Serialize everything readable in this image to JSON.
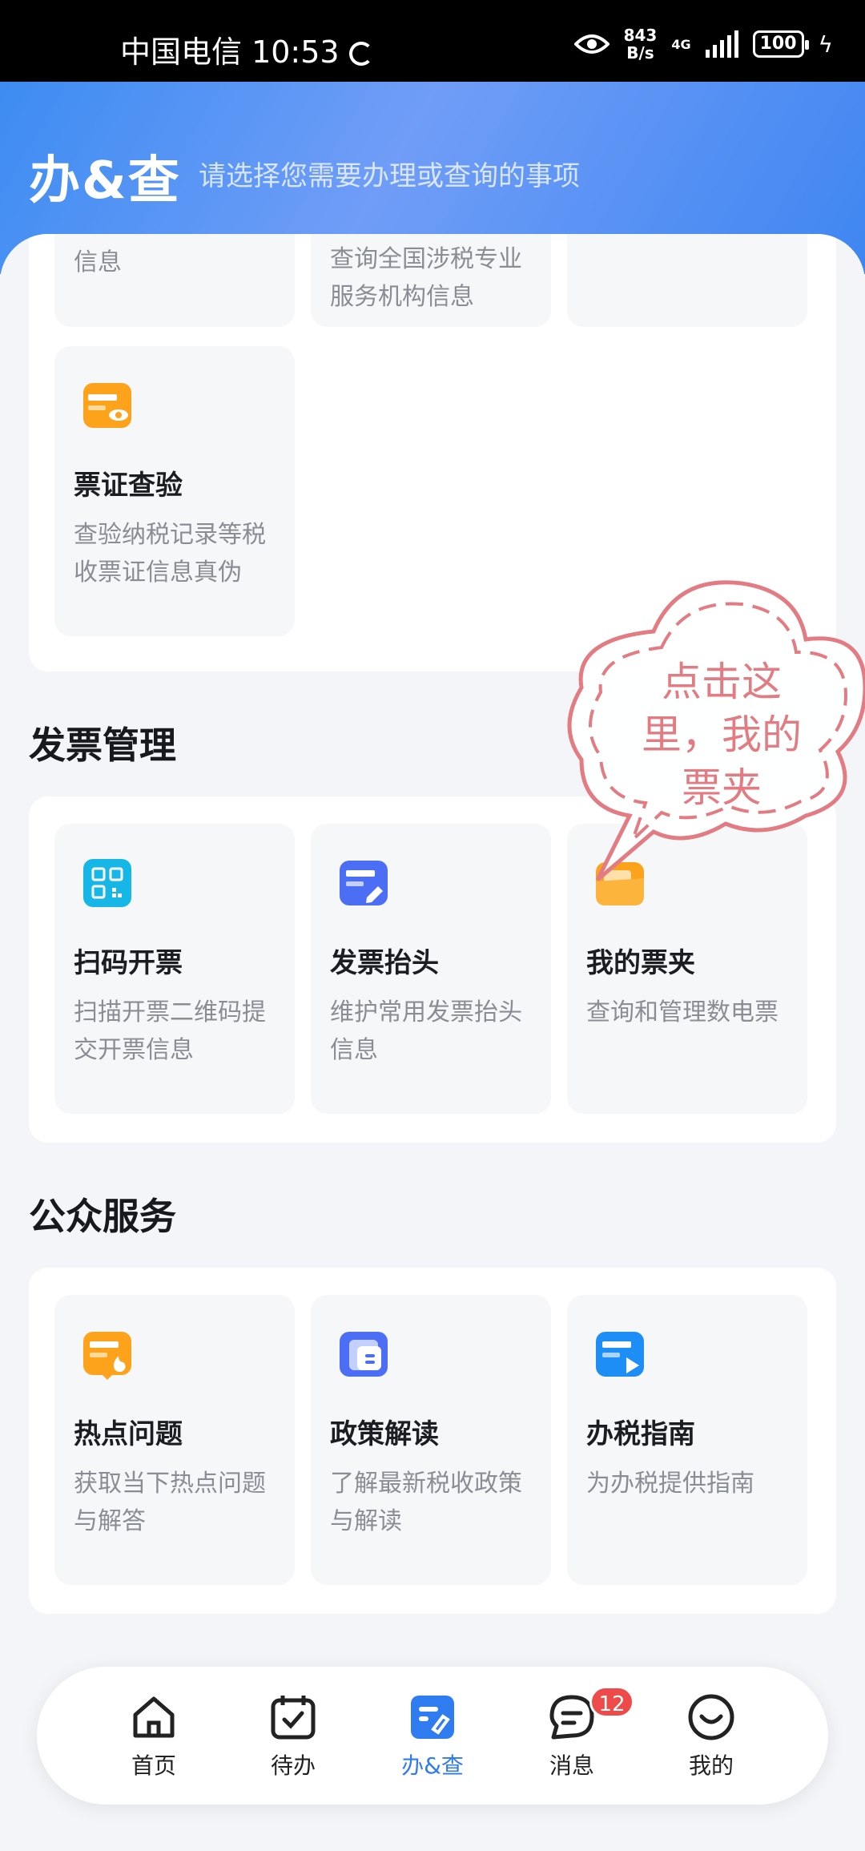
{
  "status_bar": {
    "carrier_time": "中国电信 10:53",
    "speed_value": "843",
    "speed_unit": "B/s",
    "network": "4G",
    "battery": "100"
  },
  "header": {
    "title": "办&查",
    "subtitle": "请选择您需要办理或查询的事项"
  },
  "top_card": {
    "partial_tiles": [
      {
        "desc": "信息"
      },
      {
        "desc": "查询全国涉税专业服务机构信息"
      },
      {
        "desc": ""
      }
    ],
    "tile": {
      "name": "票证查验",
      "desc": "查验纳税记录等税收票证信息真伪",
      "icon": "ticket-verify-icon"
    }
  },
  "invoice_section": {
    "title": "发票管理",
    "tiles": [
      {
        "name": "扫码开票",
        "desc": "扫描开票二维码提交开票信息",
        "icon": "qr-scan-icon"
      },
      {
        "name": "发票抬头",
        "desc": "维护常用发票抬头信息",
        "icon": "invoice-title-edit-icon"
      },
      {
        "name": "我的票夹",
        "desc": "查询和管理数电票",
        "icon": "ticket-folder-icon"
      }
    ]
  },
  "public_section": {
    "title": "公众服务",
    "tiles": [
      {
        "name": "热点问题",
        "desc": "获取当下热点问题与解答",
        "icon": "hot-topic-icon"
      },
      {
        "name": "政策解读",
        "desc": "了解最新税收政策与解读",
        "icon": "policy-folder-icon"
      },
      {
        "name": "办税指南",
        "desc": "为办税提供指南",
        "icon": "guide-play-icon"
      }
    ]
  },
  "callout": {
    "text": "点击这里，我的票夹"
  },
  "bottom_nav": {
    "items": [
      {
        "label": "首页",
        "icon": "home-icon"
      },
      {
        "label": "待办",
        "icon": "calendar-check-icon"
      },
      {
        "label": "办&查",
        "icon": "handle-query-icon",
        "active": true
      },
      {
        "label": "消息",
        "icon": "message-icon",
        "badge": "12"
      },
      {
        "label": "我的",
        "icon": "smile-icon"
      }
    ]
  },
  "colors": {
    "accent": "#2f7cf0",
    "orange": "#fda21b",
    "cyan": "#16b7e6",
    "indigo": "#4c6ef5",
    "badge": "#ee4a4a",
    "callout": "#e27b82"
  }
}
